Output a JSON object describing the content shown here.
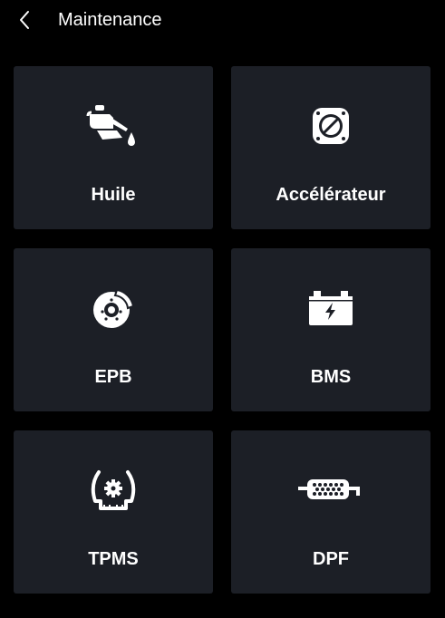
{
  "header": {
    "back_icon": "chevron-left-icon",
    "title": "Maintenance"
  },
  "tiles": [
    {
      "label": "Huile",
      "icon": "oil-can-icon"
    },
    {
      "label": "Accélérateur",
      "icon": "throttle-icon"
    },
    {
      "label": "EPB",
      "icon": "brake-disc-icon"
    },
    {
      "label": "BMS",
      "icon": "battery-icon"
    },
    {
      "label": "TPMS",
      "icon": "tire-pressure-icon"
    },
    {
      "label": "DPF",
      "icon": "particulate-filter-icon"
    }
  ],
  "colors": {
    "background": "#000000",
    "tile": "#1c1f26",
    "text": "#ffffff"
  }
}
